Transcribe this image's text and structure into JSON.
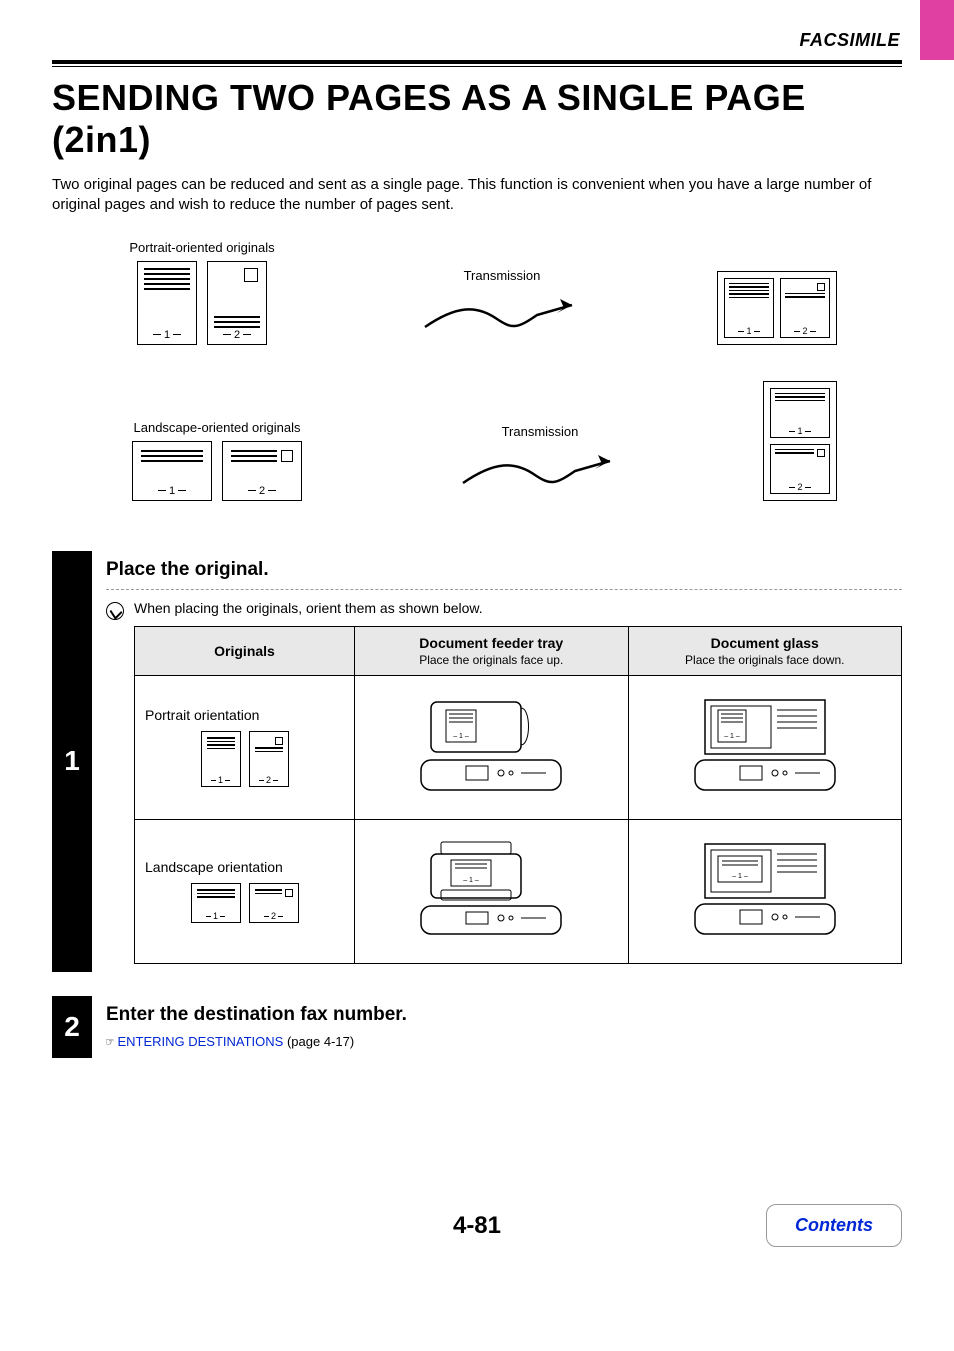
{
  "header": {
    "section": "FACSIMILE"
  },
  "title": "SENDING TWO PAGES AS A SINGLE PAGE (2in1)",
  "intro": "Two original pages can be reduced and sent as a single page. This function is convenient when you have a large number of original pages and wish to reduce the number of pages sent.",
  "diagrams": {
    "portrait_label": "Portrait-oriented originals",
    "landscape_label": "Landscape-oriented originals",
    "transmission": "Transmission",
    "page1": "1",
    "page2": "2"
  },
  "steps": {
    "s1": {
      "num": "1",
      "title": "Place the original.",
      "note": "When placing the originals, orient them as shown below.",
      "table": {
        "col_originals": "Originals",
        "col_feeder": "Document feeder tray",
        "col_feeder_sub": "Place the originals face up.",
        "col_glass": "Document glass",
        "col_glass_sub": "Place the originals face down.",
        "row_portrait": "Portrait orientation",
        "row_landscape": "Landscape orientation",
        "p1": "1",
        "p2": "2"
      }
    },
    "s2": {
      "num": "2",
      "title": "Enter the destination fax number.",
      "link_text": "ENTERING DESTINATIONS",
      "link_page": " (page 4-17)"
    }
  },
  "footer": {
    "page": "4-81",
    "contents": "Contents"
  }
}
